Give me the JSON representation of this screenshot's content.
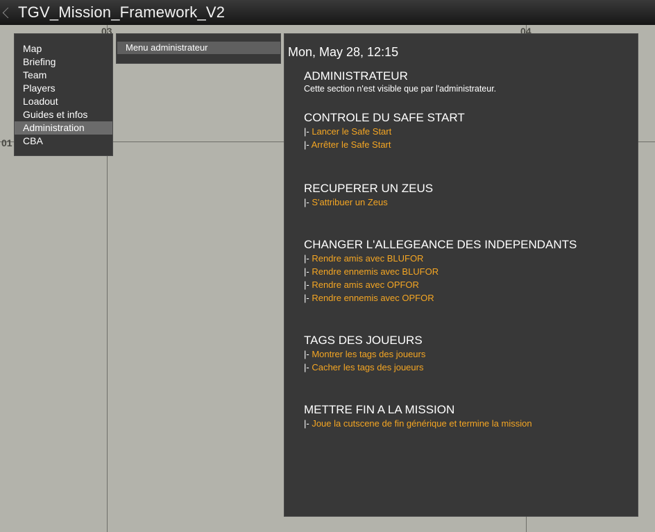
{
  "window": {
    "title": "TGV_Mission_Framework_V2"
  },
  "map": {
    "grid_labels": [
      "03",
      "04",
      "01"
    ]
  },
  "left_menu": {
    "items": [
      {
        "label": "Map"
      },
      {
        "label": "Briefing"
      },
      {
        "label": "Team"
      },
      {
        "label": "Players"
      },
      {
        "label": "Loadout"
      },
      {
        "label": "Guides et infos"
      },
      {
        "label": "Administration",
        "active": true
      },
      {
        "label": "CBA"
      }
    ]
  },
  "sub_menu": {
    "items": [
      {
        "label": "Menu administrateur"
      }
    ]
  },
  "content": {
    "datetime": "Mon, May 28,  12:15",
    "prefix": "|- ",
    "sections": [
      {
        "title": "ADMINISTRATEUR",
        "description": "Cette section n'est visible que par l'administrateur."
      },
      {
        "title": "CONTROLE DU SAFE START",
        "links": [
          "Lancer le Safe Start",
          "Arrêter le Safe Start"
        ]
      },
      {
        "title": "RECUPERER  UN ZEUS",
        "links": [
          "S'attribuer un Zeus"
        ]
      },
      {
        "title": "CHANGER L'ALLEGEANCE DES INDEPENDANTS",
        "links": [
          "Rendre amis avec BLUFOR",
          "Rendre ennemis avec BLUFOR",
          "Rendre amis avec OPFOR",
          "Rendre ennemis avec OPFOR"
        ]
      },
      {
        "title": "TAGS DES JOUEURS",
        "links": [
          "Montrer les tags des joueurs",
          "Cacher les tags des joueurs"
        ]
      },
      {
        "title": "METTRE FIN A LA MISSION",
        "links": [
          "Joue la cutscene de fin générique et termine la mission"
        ]
      }
    ]
  },
  "colors": {
    "link": "#f5a623",
    "panel": "#383838",
    "map_bg": "#b3b3ab",
    "active_item": "#6b6b6b"
  }
}
